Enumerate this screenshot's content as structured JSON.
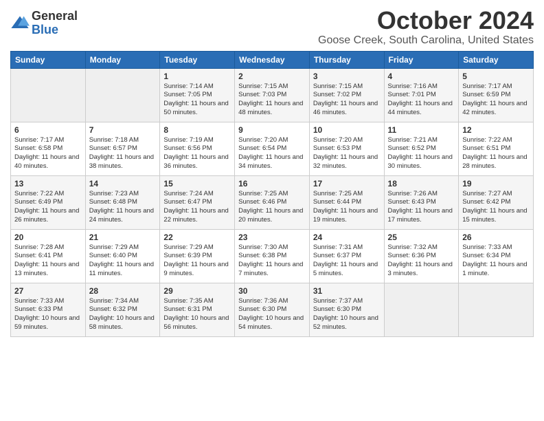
{
  "logo": {
    "general": "General",
    "blue": "Blue"
  },
  "title": "October 2024",
  "subtitle": "Goose Creek, South Carolina, United States",
  "days_of_week": [
    "Sunday",
    "Monday",
    "Tuesday",
    "Wednesday",
    "Thursday",
    "Friday",
    "Saturday"
  ],
  "weeks": [
    [
      {
        "day": null
      },
      {
        "day": null
      },
      {
        "day": 1,
        "sunrise": "7:14 AM",
        "sunset": "7:05 PM",
        "daylight": "11 hours and 50 minutes."
      },
      {
        "day": 2,
        "sunrise": "7:15 AM",
        "sunset": "7:03 PM",
        "daylight": "11 hours and 48 minutes."
      },
      {
        "day": 3,
        "sunrise": "7:15 AM",
        "sunset": "7:02 PM",
        "daylight": "11 hours and 46 minutes."
      },
      {
        "day": 4,
        "sunrise": "7:16 AM",
        "sunset": "7:01 PM",
        "daylight": "11 hours and 44 minutes."
      },
      {
        "day": 5,
        "sunrise": "7:17 AM",
        "sunset": "6:59 PM",
        "daylight": "11 hours and 42 minutes."
      }
    ],
    [
      {
        "day": 6,
        "sunrise": "7:17 AM",
        "sunset": "6:58 PM",
        "daylight": "11 hours and 40 minutes."
      },
      {
        "day": 7,
        "sunrise": "7:18 AM",
        "sunset": "6:57 PM",
        "daylight": "11 hours and 38 minutes."
      },
      {
        "day": 8,
        "sunrise": "7:19 AM",
        "sunset": "6:56 PM",
        "daylight": "11 hours and 36 minutes."
      },
      {
        "day": 9,
        "sunrise": "7:20 AM",
        "sunset": "6:54 PM",
        "daylight": "11 hours and 34 minutes."
      },
      {
        "day": 10,
        "sunrise": "7:20 AM",
        "sunset": "6:53 PM",
        "daylight": "11 hours and 32 minutes."
      },
      {
        "day": 11,
        "sunrise": "7:21 AM",
        "sunset": "6:52 PM",
        "daylight": "11 hours and 30 minutes."
      },
      {
        "day": 12,
        "sunrise": "7:22 AM",
        "sunset": "6:51 PM",
        "daylight": "11 hours and 28 minutes."
      }
    ],
    [
      {
        "day": 13,
        "sunrise": "7:22 AM",
        "sunset": "6:49 PM",
        "daylight": "11 hours and 26 minutes."
      },
      {
        "day": 14,
        "sunrise": "7:23 AM",
        "sunset": "6:48 PM",
        "daylight": "11 hours and 24 minutes."
      },
      {
        "day": 15,
        "sunrise": "7:24 AM",
        "sunset": "6:47 PM",
        "daylight": "11 hours and 22 minutes."
      },
      {
        "day": 16,
        "sunrise": "7:25 AM",
        "sunset": "6:46 PM",
        "daylight": "11 hours and 20 minutes."
      },
      {
        "day": 17,
        "sunrise": "7:25 AM",
        "sunset": "6:44 PM",
        "daylight": "11 hours and 19 minutes."
      },
      {
        "day": 18,
        "sunrise": "7:26 AM",
        "sunset": "6:43 PM",
        "daylight": "11 hours and 17 minutes."
      },
      {
        "day": 19,
        "sunrise": "7:27 AM",
        "sunset": "6:42 PM",
        "daylight": "11 hours and 15 minutes."
      }
    ],
    [
      {
        "day": 20,
        "sunrise": "7:28 AM",
        "sunset": "6:41 PM",
        "daylight": "11 hours and 13 minutes."
      },
      {
        "day": 21,
        "sunrise": "7:29 AM",
        "sunset": "6:40 PM",
        "daylight": "11 hours and 11 minutes."
      },
      {
        "day": 22,
        "sunrise": "7:29 AM",
        "sunset": "6:39 PM",
        "daylight": "11 hours and 9 minutes."
      },
      {
        "day": 23,
        "sunrise": "7:30 AM",
        "sunset": "6:38 PM",
        "daylight": "11 hours and 7 minutes."
      },
      {
        "day": 24,
        "sunrise": "7:31 AM",
        "sunset": "6:37 PM",
        "daylight": "11 hours and 5 minutes."
      },
      {
        "day": 25,
        "sunrise": "7:32 AM",
        "sunset": "6:36 PM",
        "daylight": "11 hours and 3 minutes."
      },
      {
        "day": 26,
        "sunrise": "7:33 AM",
        "sunset": "6:34 PM",
        "daylight": "11 hours and 1 minute."
      }
    ],
    [
      {
        "day": 27,
        "sunrise": "7:33 AM",
        "sunset": "6:33 PM",
        "daylight": "10 hours and 59 minutes."
      },
      {
        "day": 28,
        "sunrise": "7:34 AM",
        "sunset": "6:32 PM",
        "daylight": "10 hours and 58 minutes."
      },
      {
        "day": 29,
        "sunrise": "7:35 AM",
        "sunset": "6:31 PM",
        "daylight": "10 hours and 56 minutes."
      },
      {
        "day": 30,
        "sunrise": "7:36 AM",
        "sunset": "6:30 PM",
        "daylight": "10 hours and 54 minutes."
      },
      {
        "day": 31,
        "sunrise": "7:37 AM",
        "sunset": "6:30 PM",
        "daylight": "10 hours and 52 minutes."
      },
      {
        "day": null
      },
      {
        "day": null
      }
    ]
  ]
}
